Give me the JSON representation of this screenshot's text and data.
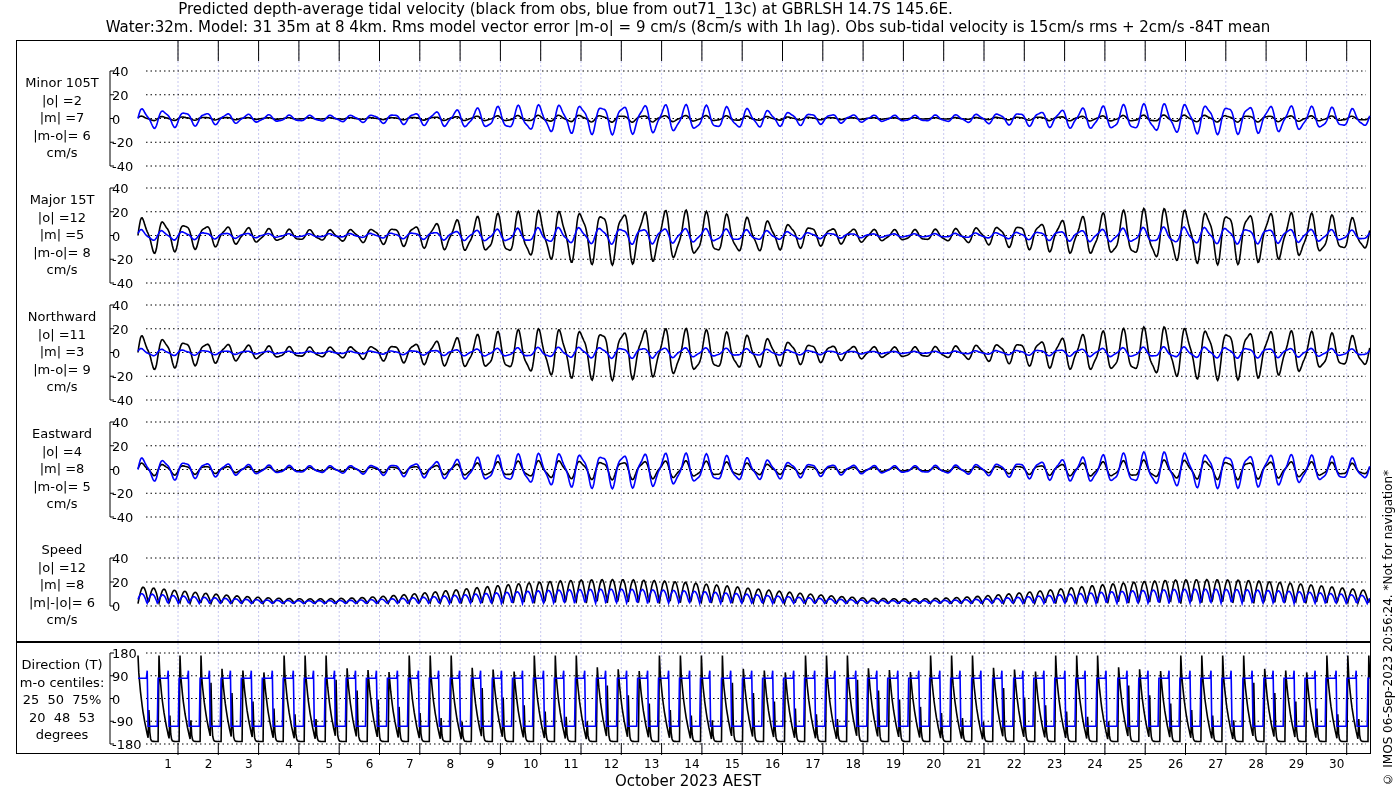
{
  "title": {
    "line_1": "Predicted depth-average tidal velocity (black from obs, blue from out71_13c) at GBRLSH 14.7S 145.6E.",
    "line_2": "Water:32m. Model: 31 35m at 8 4km. Rms model vector error |m-o| = 9 cm/s (8cm/s with 1h lag). Obs sub-tidal velocity is 15cm/s rms + 2cm/s -84T mean"
  },
  "panels": [
    {
      "kind": "minor",
      "label_lines": [
        "Minor 105T",
        "|o| =2",
        "|m| =7",
        "|m-o|= 6",
        "cm/s"
      ],
      "yticks": [
        "40",
        "20",
        "0",
        "-20",
        "-40"
      ]
    },
    {
      "kind": "major",
      "label_lines": [
        "Major 15T",
        "|o| =12",
        "|m| =5",
        "|m-o|= 8",
        "cm/s"
      ],
      "yticks": [
        "40",
        "20",
        "0",
        "-20",
        "-40"
      ]
    },
    {
      "kind": "northward",
      "label_lines": [
        "Northward",
        "|o| =11",
        "|m| =3",
        "|m-o|= 9",
        "cm/s"
      ],
      "yticks": [
        "40",
        "20",
        "0",
        "-20",
        "-40"
      ]
    },
    {
      "kind": "eastward",
      "label_lines": [
        "Eastward",
        "|o| =4",
        "|m| =8",
        "|m-o|= 5",
        "cm/s"
      ],
      "yticks": [
        "40",
        "20",
        "0",
        "-20",
        "-40"
      ]
    },
    {
      "kind": "speed",
      "label_lines": [
        "Speed",
        "|o| =12",
        "|m| =8",
        "|m|-|o|= 6",
        "cm/s"
      ],
      "yticks": [
        "40",
        "20",
        "0"
      ]
    },
    {
      "kind": "direction",
      "label_lines": [
        "Direction (T)",
        "m-o centiles:",
        "25  50  75%",
        "20  48  53",
        "degrees"
      ],
      "yticks": [
        "180",
        "90",
        "0",
        "-90",
        "-180"
      ]
    }
  ],
  "xaxis": {
    "ticks": [
      "1",
      "2",
      "3",
      "4",
      "5",
      "6",
      "7",
      "8",
      "9",
      "10",
      "11",
      "12",
      "13",
      "14",
      "15",
      "16",
      "17",
      "18",
      "19",
      "20",
      "21",
      "22",
      "23",
      "24",
      "25",
      "26",
      "27",
      "28",
      "29",
      "30"
    ],
    "label": "October 2023 AEST"
  },
  "credit": "© IMOS 06-Sep-2023 20:56:24. *Not for navigation*"
}
